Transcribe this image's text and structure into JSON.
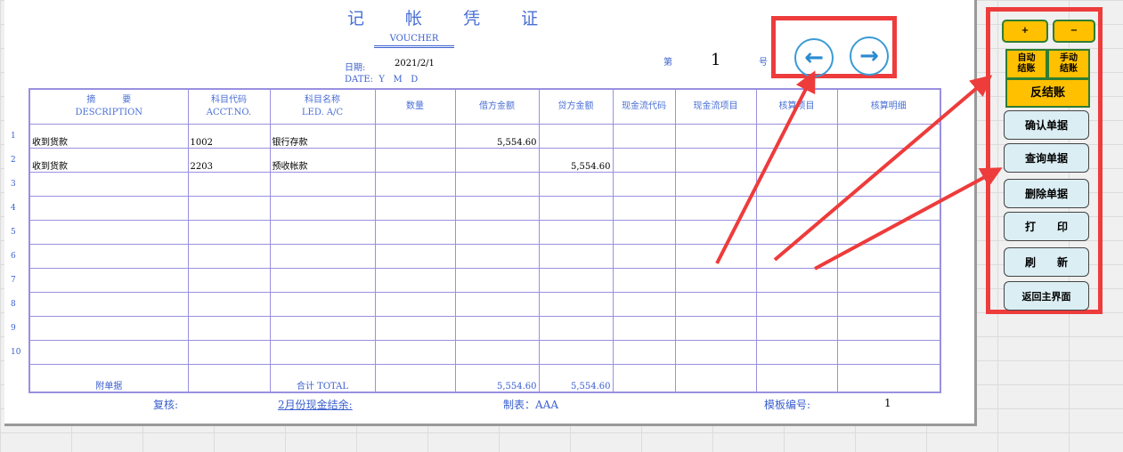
{
  "voucher": {
    "title": "记 帐 凭 证",
    "subtitle": "VOUCHER",
    "date_label": "日期:",
    "date_value": "2021/2/1",
    "date_en": "DATE:  Y   M   D",
    "no_prefix": "第",
    "no_value": "1",
    "no_suffix": "号"
  },
  "table": {
    "headers": [
      [
        "摘　　　要",
        "DESCRIPTION"
      ],
      [
        "科目代码",
        "ACCT.NO."
      ],
      [
        "科目名称",
        "LED. A/C"
      ],
      [
        "数量",
        ""
      ],
      [
        "借方金额",
        ""
      ],
      [
        "贷方金额",
        ""
      ],
      [
        "现金流代码",
        ""
      ],
      [
        "现金流项目",
        ""
      ],
      [
        "核算项目",
        ""
      ],
      [
        "核算明细",
        ""
      ]
    ],
    "rows": [
      {
        "no": "1",
        "desc": "收到货款",
        "code": "1002",
        "name": "银行存款",
        "debit": "5,554.60",
        "credit": ""
      },
      {
        "no": "2",
        "desc": "收到货款",
        "code": "2203",
        "name": "预收帐款",
        "debit": "",
        "credit": "5,554.60"
      },
      {
        "no": "3"
      },
      {
        "no": "4"
      },
      {
        "no": "5"
      },
      {
        "no": "6"
      },
      {
        "no": "7"
      },
      {
        "no": "8"
      },
      {
        "no": "9"
      },
      {
        "no": "10"
      }
    ],
    "attach_label": "附单据",
    "total_label": "合计  TOTAL",
    "total_debit": "5,554.60",
    "total_credit": "5,554.60"
  },
  "footer": {
    "review": "复核:",
    "cash_balance": "2月份现金结余:",
    "maker": "制表：AAA",
    "template_label": "模板编号:",
    "template_no": "1"
  },
  "panel": {
    "plus": "+",
    "minus": "−",
    "auto_close": "自动结账",
    "manual_close": "手动结账",
    "reverse_close": "反结账",
    "confirm": "确认单据",
    "query": "查询单据",
    "delete": "删除单据",
    "print": "打　　印",
    "refresh": "刷　　新",
    "back": "返回主界面"
  },
  "nav": {
    "prev": "←",
    "next": "→"
  }
}
